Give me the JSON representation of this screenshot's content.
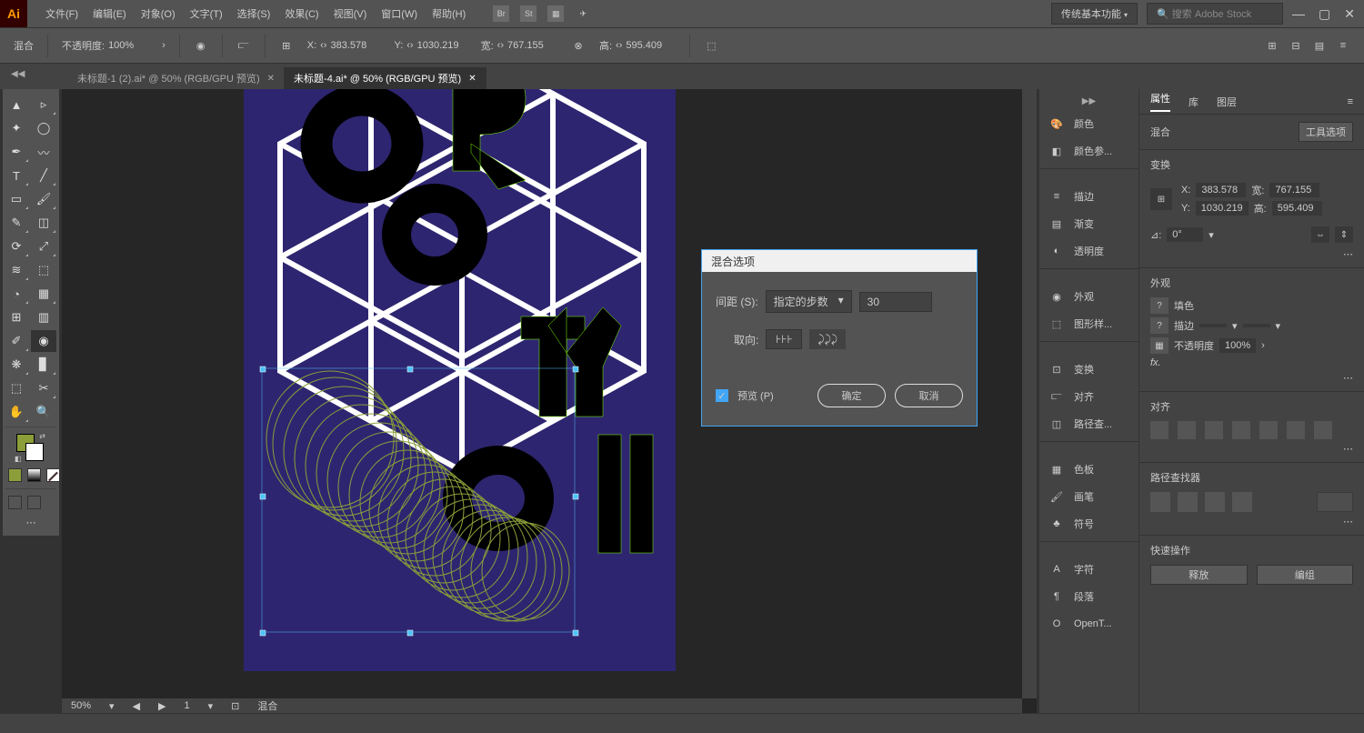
{
  "app": {
    "logo": "Ai"
  },
  "menu": [
    "文件(F)",
    "编辑(E)",
    "对象(O)",
    "文字(T)",
    "选择(S)",
    "效果(C)",
    "视图(V)",
    "窗口(W)",
    "帮助(H)"
  ],
  "titlebar": {
    "workspace": "传统基本功能",
    "search_placeholder": "搜索 Adobe Stock"
  },
  "controlbar": {
    "selection": "混合",
    "opacity_label": "不透明度:",
    "opacity": "100%",
    "x_label": "X:",
    "x": "383.578",
    "y_label": "Y:",
    "y": "1030.219",
    "w_label": "宽:",
    "w": "767.155",
    "h_label": "高:",
    "h": "595.409"
  },
  "tabs": [
    {
      "label": "未标题-1 (2).ai* @ 50% (RGB/GPU 预览)",
      "active": false
    },
    {
      "label": "未标题-4.ai* @ 50% (RGB/GPU 预览)",
      "active": true
    }
  ],
  "dialog": {
    "title": "混合选项",
    "spacing_label": "间距 (S):",
    "spacing_type": "指定的步数",
    "steps": "30",
    "orient_label": "取向:",
    "preview_label": "预览 (P)",
    "ok": "确定",
    "cancel": "取消"
  },
  "side1": [
    "颜色",
    "颜色参...",
    "描边",
    "渐变",
    "透明度",
    "外观",
    "图形样...",
    "变换",
    "对齐",
    "路径查...",
    "色板",
    "画笔",
    "符号",
    "字符",
    "段落",
    "OpenT..."
  ],
  "side2": {
    "tabs": [
      "属性",
      "库",
      "图层"
    ],
    "selection": "混合",
    "tool_opts": "工具选项",
    "transform_title": "变换",
    "x_label": "X:",
    "x": "383.578",
    "y_label": "Y:",
    "y": "1030.219",
    "w_label": "宽:",
    "w": "767.155",
    "h_label": "高:",
    "h": "595.409",
    "angle_label": "⊿:",
    "angle": "0°",
    "appear_title": "外观",
    "fill_label": "填色",
    "stroke_label": "描边",
    "op_label": "不透明度",
    "op_val": "100%",
    "align_title": "对齐",
    "pf_title": "路径查找器",
    "quick_title": "快速操作",
    "release": "释放",
    "group": "编组"
  },
  "footer": {
    "zoom": "50%",
    "page": "1",
    "status": "混合"
  }
}
